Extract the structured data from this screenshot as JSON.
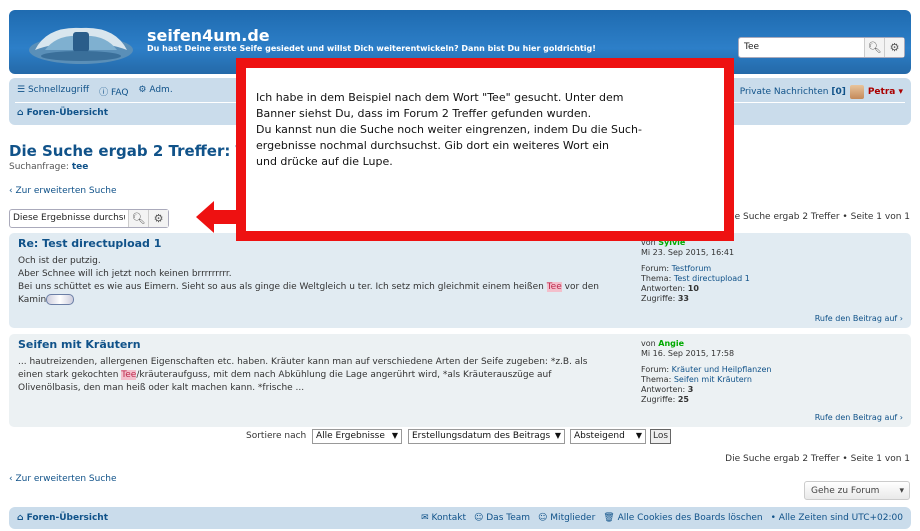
{
  "header": {
    "site_title": "seifen4um.de",
    "site_description": "Du hast Deine erste Seife gesiedet und willst Dich weiterentwickeln? Dann bist Du hier goldrichtig!",
    "search_value": "Tee"
  },
  "nav": {
    "quicklinks": "Schnellzugriff",
    "faq": "FAQ",
    "adm": "Adm.",
    "board_index": "Foren-Übersicht",
    "private_messages": "Private Nachrichten",
    "pm_count": "[0]",
    "username": "Petra"
  },
  "search": {
    "title": "Die Suche ergab 2 Treffer: Tee",
    "query_label": "Suchanfrage:",
    "query_value": "tee",
    "advanced_link": "Zur erweiterten Suche",
    "refine_value": "Diese Ergebnisse durchsuchen",
    "pagination": "Die Suche ergab 2 Treffer • Seite 1 von 1"
  },
  "results": [
    {
      "title": "Re: Test directupload 1",
      "line1": "Och ist der putzig.",
      "line2": "Aber Schnee will ich jetzt noch keinen brrrrrrrrr.",
      "line3_pre": "Bei uns schüttet es wie aus Eimern. Sieht so aus als ginge die Weltgleich u ter. Ich setz mich gleichmit einem heißen ",
      "highlight": "Tee",
      "line3_post": " vor den",
      "line4": "Kamin",
      "by_label": "von",
      "author": "Sylvie",
      "date": "Mi 23. Sep 2015, 16:41",
      "forum_label": "Forum:",
      "forum": "Testforum",
      "topic_label": "Thema:",
      "topic": "Test directupload 1",
      "replies_label": "Antworten:",
      "replies": "10",
      "views_label": "Zugriffe:",
      "views": "33",
      "jump": "Rufe den Beitrag auf"
    },
    {
      "title": "Seifen mit Kräutern",
      "line1": "... hautreizenden, allergenen Eigenschaften etc. haben. Kräuter kann man auf verschiedene Arten der Seife zugeben: *z.B. als",
      "line2_pre": "einen stark gekochten ",
      "highlight": "Tee",
      "line2_post": "/kräuteraufguss, mit dem nach Abkühlung die Lage angerührt wird, *als Kräuterauszüge auf",
      "line3": "Olivenölbasis, den man heiß oder kalt machen kann. *frische ...",
      "by_label": "von",
      "author": "Angie",
      "date": "Mi 16. Sep 2015, 17:58",
      "forum_label": "Forum:",
      "forum": "Kräuter und Heilpflanzen",
      "topic_label": "Thema:",
      "topic": "Seifen mit Kräutern",
      "replies_label": "Antworten:",
      "replies": "3",
      "views_label": "Zugriffe:",
      "views": "25",
      "jump": "Rufe den Beitrag auf"
    }
  ],
  "sort": {
    "label": "Sortiere nach",
    "filter": "Alle Ergebnisse",
    "key": "Erstellungsdatum des Beitrags",
    "direction": "Absteigend",
    "go": "Los"
  },
  "jump_to": "Gehe zu Forum",
  "footer": {
    "board_index": "Foren-Übersicht",
    "contact": "Kontakt",
    "team": "Das Team",
    "members": "Mitglieder",
    "delete_cookies": "Alle Cookies des Boards löschen",
    "timezone": "• Alle Zeiten sind UTC+02:00"
  },
  "callout": {
    "line1": "Ich habe in dem Beispiel nach dem Wort \"Tee\" gesucht. Unter dem",
    "line2": "Banner siehst Du, dass im Forum 2 Treffer gefunden wurden.",
    "line3": "Du kannst nun die Suche noch weiter eingrenzen, indem Du die Such-",
    "line4": "ergebnisse nochmal durchsuchst. Gib dort ein weiteres Wort ein",
    "line5": "und drücke auf die Lupe.",
    "border_color": "#ee1111"
  }
}
